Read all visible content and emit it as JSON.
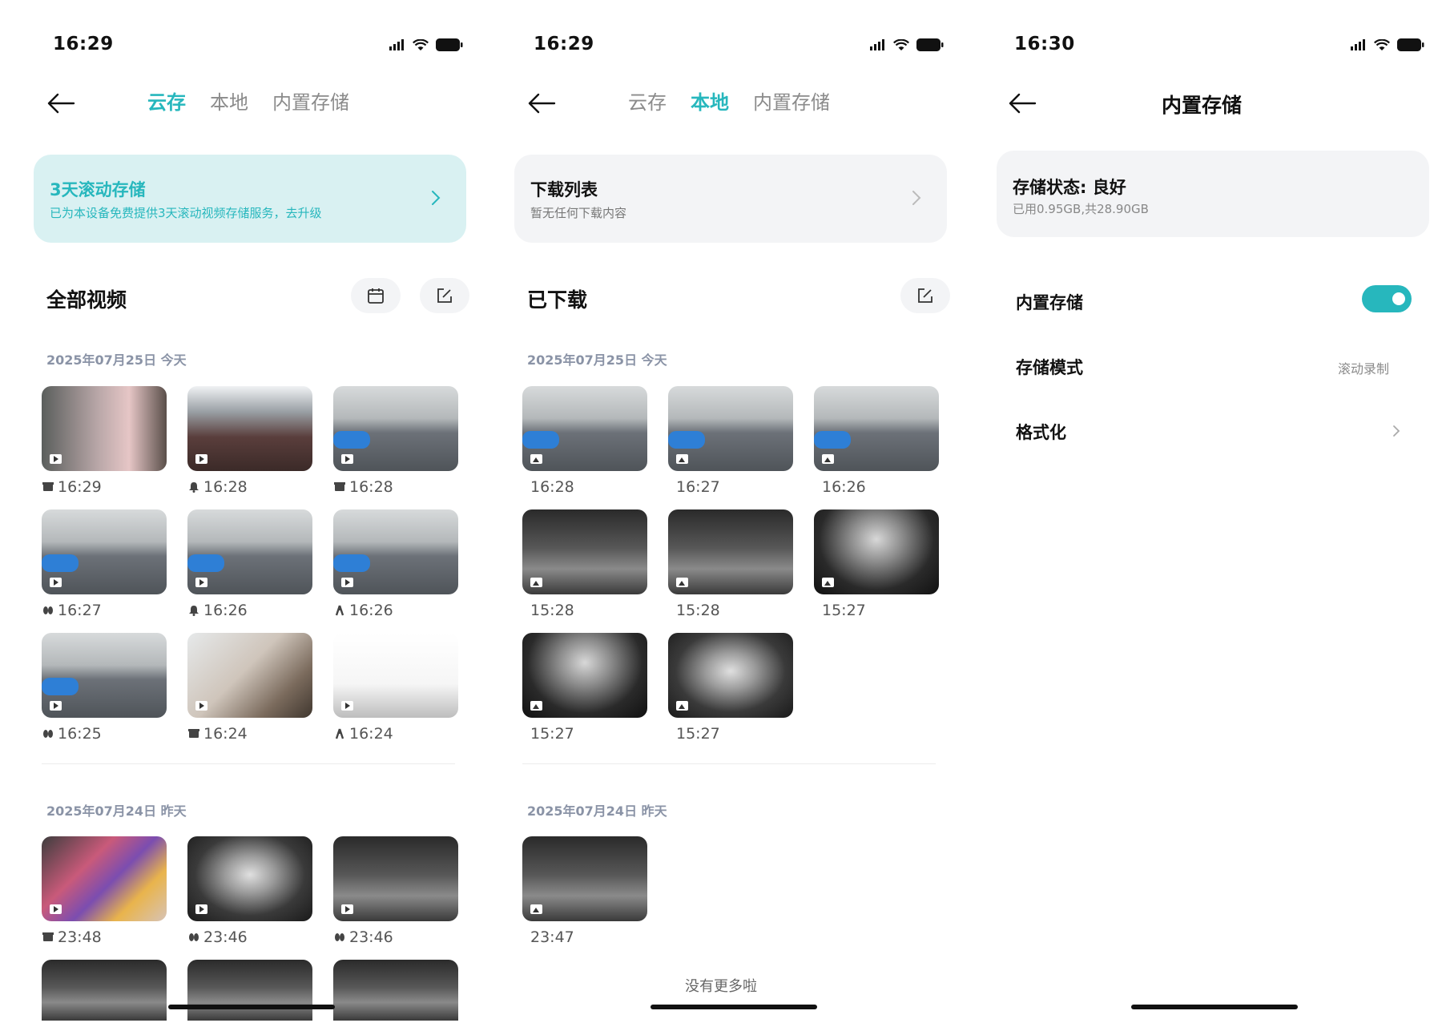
{
  "colors": {
    "accent": "#27b7bd",
    "text": "#111111",
    "muted": "#8b8b8b",
    "card": "#f3f4f6",
    "teal_card": "#d9f1f2"
  },
  "screen1": {
    "status_time": "16:29",
    "tabs": [
      {
        "label": "云存",
        "active": true
      },
      {
        "label": "本地",
        "active": false
      },
      {
        "label": "内置存储",
        "active": false
      }
    ],
    "banner": {
      "title": "3天滚动存储",
      "subtitle": "已为本设备免费提供3天滚动视频存储服务，去升级"
    },
    "section_title": "全部视频",
    "group1": {
      "date": "2025年07月25日  今天",
      "items": [
        {
          "time": "16:29",
          "event_icon": "package-icon"
        },
        {
          "time": "16:28",
          "event_icon": "bell-icon"
        },
        {
          "time": "16:28",
          "event_icon": "package-icon"
        },
        {
          "time": "16:27",
          "event_icon": "footprints-icon"
        },
        {
          "time": "16:26",
          "event_icon": "bell-icon"
        },
        {
          "time": "16:26",
          "event_icon": "person-walking-icon"
        },
        {
          "time": "16:25",
          "event_icon": "footprints-icon"
        },
        {
          "time": "16:24",
          "event_icon": "package-icon"
        },
        {
          "time": "16:24",
          "event_icon": "person-walking-icon"
        }
      ]
    },
    "group2": {
      "date": "2025年07月24日  昨天",
      "items": [
        {
          "time": "23:48",
          "event_icon": "package-icon"
        },
        {
          "time": "23:46",
          "event_icon": "footprints-icon"
        },
        {
          "time": "23:46",
          "event_icon": "footprints-icon"
        }
      ]
    }
  },
  "screen2": {
    "status_time": "16:29",
    "tabs": [
      {
        "label": "云存",
        "active": false
      },
      {
        "label": "本地",
        "active": true
      },
      {
        "label": "内置存储",
        "active": false
      }
    ],
    "banner": {
      "title": "下载列表",
      "subtitle": "暂无任何下载内容"
    },
    "section_title": "已下载",
    "group1": {
      "date": "2025年07月25日  今天",
      "items": [
        {
          "time": "16:28"
        },
        {
          "time": "16:27"
        },
        {
          "time": "16:26"
        },
        {
          "time": "15:28"
        },
        {
          "time": "15:28"
        },
        {
          "time": "15:27"
        },
        {
          "time": "15:27"
        },
        {
          "time": "15:27"
        }
      ]
    },
    "group2": {
      "date": "2025年07月24日  昨天",
      "items": [
        {
          "time": "23:47"
        }
      ]
    },
    "no_more": "没有更多啦"
  },
  "screen3": {
    "status_time": "16:30",
    "title": "内置存储",
    "status_card": {
      "title": "存储状态: 良好",
      "subtitle": "已用0.95GB,共28.90GB"
    },
    "rows": {
      "builtin_storage": {
        "label": "内置存储",
        "enabled": true
      },
      "storage_mode": {
        "label": "存储模式",
        "value": "滚动录制"
      },
      "format": {
        "label": "格式化"
      }
    }
  }
}
